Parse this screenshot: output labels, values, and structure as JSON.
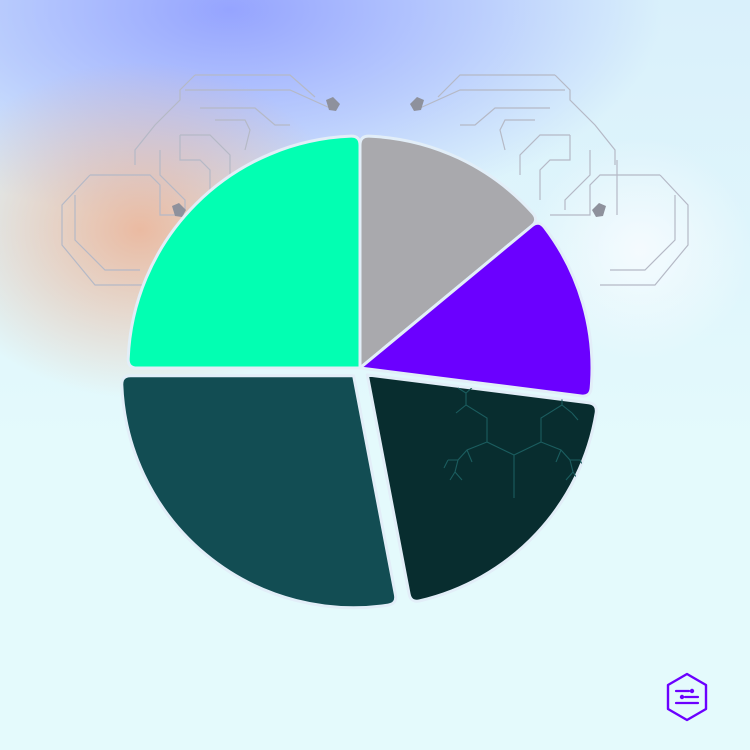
{
  "chart_data": {
    "type": "pie",
    "title": "",
    "legend": "none",
    "series": [
      {
        "values": [
          14,
          13,
          20,
          28,
          25
        ],
        "colors": [
          "#a9a9ad",
          "#6b00ff",
          "#082d2f",
          "#124d53",
          "#02ffb2"
        ],
        "exploded": [
          false,
          false,
          true,
          true,
          false
        ]
      }
    ]
  },
  "theme": {
    "background": "#e4fafc",
    "separator": "#e2eef8",
    "circuit_line": "#b5b9c6",
    "circuit_node": "#8e919c",
    "tree_line": "#1b5d5f"
  },
  "logo": {
    "icon": "hexagon-logo-icon",
    "color": "#6b00ff"
  }
}
